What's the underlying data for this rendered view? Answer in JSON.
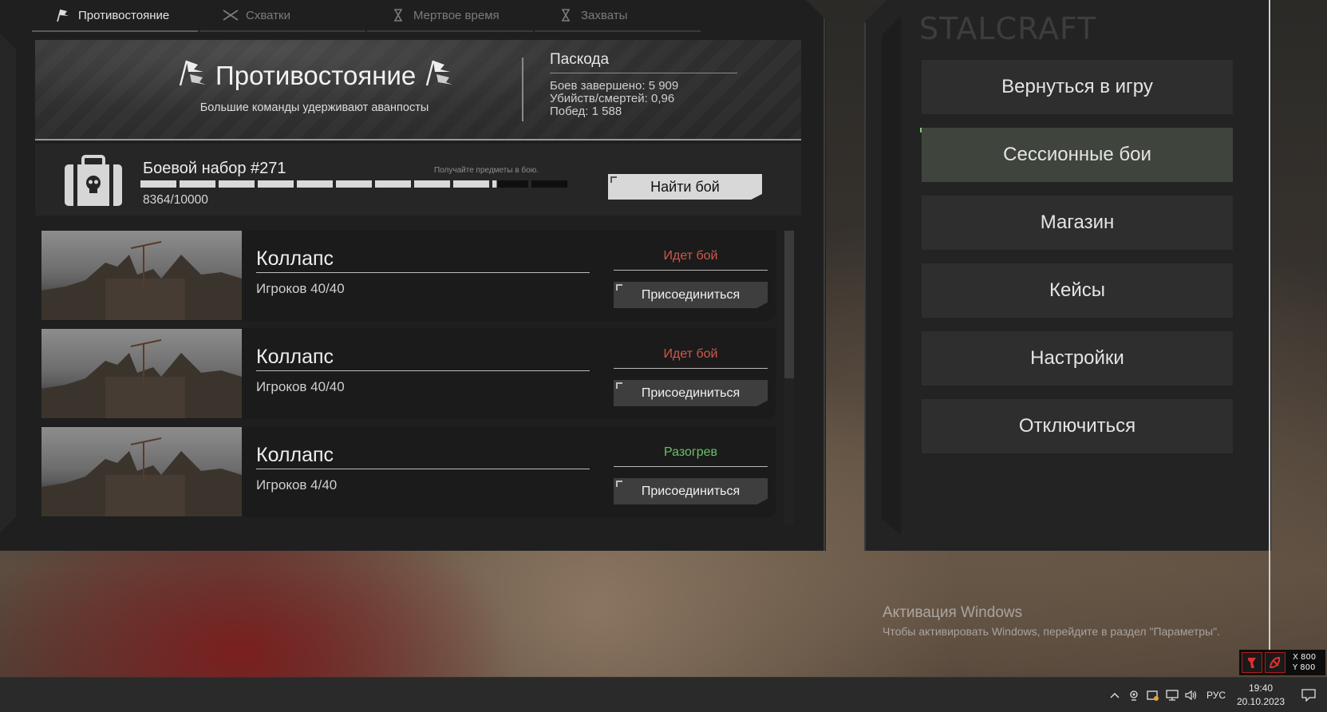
{
  "tabs": [
    {
      "label": "Противостояние",
      "icon": "flags-icon",
      "active": true
    },
    {
      "label": "Схватки",
      "icon": "crossed-swords-icon",
      "active": false
    },
    {
      "label": "Мертвое время",
      "icon": "hourglass-icon",
      "active": false
    },
    {
      "label": "Захваты",
      "icon": "hourglass-icon",
      "active": false
    }
  ],
  "mode": {
    "title": "Противостояние",
    "subtitle": "Большие команды удерживают аванпосты"
  },
  "player": {
    "name": "Паскода",
    "battles_label": "Боев завершено: 5 909",
    "kd_label": "Убийств/смертей: 0,96",
    "wins_label": "Побед: 1 588"
  },
  "kit": {
    "title": "Боевой набор #271",
    "hint": "Получайте предметы в бою.",
    "progress_text": "8364/10000",
    "progress": 0.8364,
    "find_button": "Найти бой"
  },
  "matches": [
    {
      "map": "Коллапс",
      "players": "Игроков 40/40",
      "status": "Идет бой",
      "status_color": "#d0584c",
      "join": "Присоединиться"
    },
    {
      "map": "Коллапс",
      "players": "Игроков 40/40",
      "status": "Идет бой",
      "status_color": "#d0584c",
      "join": "Присоединиться"
    },
    {
      "map": "Коллапс",
      "players": "Игроков 4/40",
      "status": "Разогрев",
      "status_color": "#6cbf6a",
      "join": "Присоединиться"
    }
  ],
  "menu": {
    "game_title": "STALCRAFT",
    "items": [
      {
        "label": "Вернуться в игру",
        "active": false
      },
      {
        "label": "Сессионные бои",
        "active": true
      },
      {
        "label": "Магазин",
        "active": false
      },
      {
        "label": "Кейсы",
        "active": false
      },
      {
        "label": "Настройки",
        "active": false
      },
      {
        "label": "Отключиться",
        "active": false
      }
    ]
  },
  "watermark": {
    "title": "Активация Windows",
    "subtitle": "Чтобы активировать Windows, перейдите в раздел \"Параметры\"."
  },
  "overlay": {
    "x": "X 800",
    "y": "Y 800"
  },
  "taskbar": {
    "language": "РУС",
    "time": "19:40",
    "date": "20.10.2023"
  }
}
